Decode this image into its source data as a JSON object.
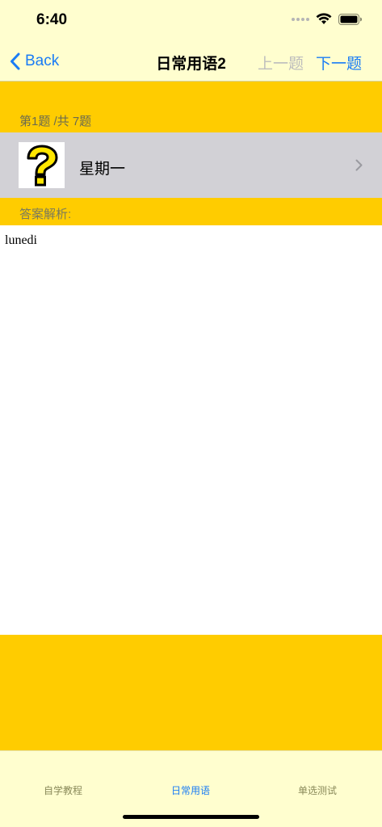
{
  "status_bar": {
    "time": "6:40"
  },
  "nav": {
    "back_label": "Back",
    "title": "日常用语2",
    "prev_label": "上一题",
    "next_label": "下一题"
  },
  "question": {
    "counter": "第1题 /共 7题",
    "item_label": "星期一",
    "thumbnail_icon": "question-mark-icon"
  },
  "analysis": {
    "header": "答案解析:",
    "text": "lunedi"
  },
  "tabs": [
    {
      "label": "自学教程",
      "active": false
    },
    {
      "label": "日常用语",
      "active": true
    },
    {
      "label": "单选测试",
      "active": false
    }
  ],
  "colors": {
    "accent": "#1a7cf5",
    "background": "#fffecf",
    "content_yellow": "#ffcc00",
    "cell_gray": "#d2d1d6"
  }
}
